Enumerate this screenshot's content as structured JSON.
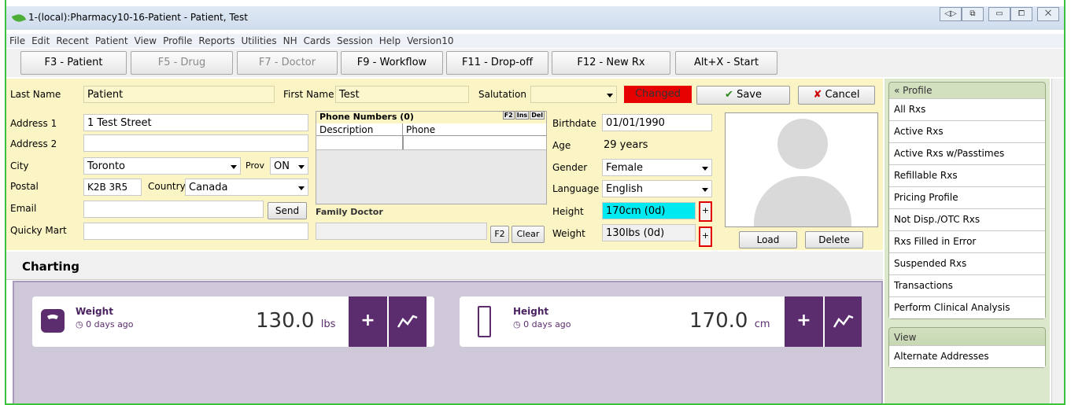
{
  "window": {
    "title": "1-(local):Pharmacy10-16-Patient - Patient, Test",
    "btns": [
      "◁▷",
      "⧉",
      "▭",
      "⧠",
      "⨉"
    ]
  },
  "menu": [
    "File",
    "Edit",
    "Recent",
    "Patient",
    "View",
    "Profile",
    "Reports",
    "Utilities",
    "NH",
    "Cards",
    "Session",
    "Help",
    "Version10"
  ],
  "toolbar": [
    {
      "label": "F3 - Patient",
      "enabled": true
    },
    {
      "label": "F5 - Drug",
      "enabled": false
    },
    {
      "label": "F7 - Doctor",
      "enabled": false
    },
    {
      "label": "F9 - Workflow",
      "enabled": true
    },
    {
      "label": "F11 - Drop-off",
      "enabled": true
    },
    {
      "label": "F12 - New Rx",
      "enabled": true
    },
    {
      "label": "Alt+X - Start",
      "enabled": true
    }
  ],
  "form": {
    "last_name_label": "Last Name",
    "last_name": "Patient",
    "first_name_label": "First Name",
    "first_name": "Test",
    "salutation_label": "Salutation",
    "salutation": "",
    "changed": "Changed",
    "save": "Save",
    "cancel": "Cancel",
    "address1_label": "Address 1",
    "address1": "1 Test Street",
    "address2_label": "Address 2",
    "address2": "",
    "city_label": "City",
    "city": "Toronto",
    "prov_label": "Prov",
    "prov": "ON",
    "postal_label": "Postal",
    "postal": "K2B 3R5",
    "country_label": "Country",
    "country": "Canada",
    "email_label": "Email",
    "email": "",
    "send": "Send",
    "quicky_label": "Quicky Mart",
    "quicky": "",
    "phone_title": "Phone Numbers (0)",
    "phone_keys": [
      "F2",
      "Ins",
      "Del"
    ],
    "phone_cols": [
      "Description",
      "Phone"
    ],
    "family_doctor_label": "Family Doctor",
    "family_doctor": "",
    "f2": "F2",
    "clear": "Clear",
    "birthdate_label": "Birthdate",
    "birthdate": "01/01/1990",
    "age_label": "Age",
    "age": "29 years",
    "gender_label": "Gender",
    "gender": "Female",
    "language_label": "Language",
    "language": "English",
    "height_label": "Height",
    "height": "170cm (0d)",
    "weight_label": "Weight",
    "weight": "130lbs (0d)",
    "plus": "+",
    "load": "Load",
    "delete": "Delete"
  },
  "charting": {
    "title": "Charting",
    "cards": [
      {
        "title": "Weight",
        "sub": "0 days ago",
        "value": "130.0",
        "unit": "lbs"
      },
      {
        "title": "Height",
        "sub": "0 days ago",
        "value": "170.0",
        "unit": "cm"
      }
    ]
  },
  "sidebar": {
    "profile_title": "Profile",
    "profile_items": [
      "All Rxs",
      "Active Rxs",
      "Active Rxs w/Passtimes",
      "Refillable Rxs",
      "Pricing Profile",
      "Not Disp./OTC Rxs",
      "Rxs Filled in Error",
      "Suspended Rxs",
      "Transactions",
      "Perform Clinical Analysis"
    ],
    "view_title": "View",
    "view_items": [
      "Alternate Addresses"
    ]
  }
}
